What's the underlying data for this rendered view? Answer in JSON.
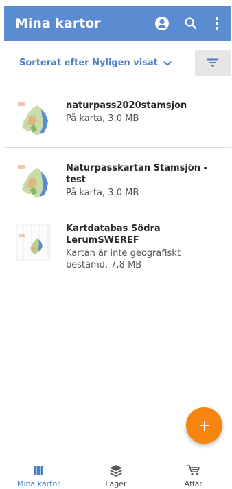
{
  "colors": {
    "primary": "#5b8bd0",
    "accent_text": "#4a7fc6",
    "fab": "#f5850f",
    "divider": "#dcdcdc"
  },
  "appbar": {
    "title": "Mina kartor",
    "icons": [
      "account-icon",
      "search-icon",
      "more-vert-icon"
    ]
  },
  "sort": {
    "label": "Sorterat efter Nyligen visat"
  },
  "maps": [
    {
      "title": "naturpass2020stamsjon",
      "subtitle": "På karta, 3,0 MB"
    },
    {
      "title": "Naturpasskartan Stamsjön - test",
      "subtitle": "På karta, 3,0 MB"
    },
    {
      "title": "Kartdatabas Södra LerumSWEREF",
      "subtitle": "Kartan är inte geografiskt bestämd, 7,8 MB"
    }
  ],
  "fab": {
    "icon": "plus-icon"
  },
  "bottom_nav": {
    "items": [
      {
        "label": "Mina kartor",
        "icon": "map-icon",
        "active": true
      },
      {
        "label": "Lager",
        "icon": "layers-icon",
        "active": false
      },
      {
        "label": "Affär",
        "icon": "cart-icon",
        "active": false
      }
    ]
  }
}
